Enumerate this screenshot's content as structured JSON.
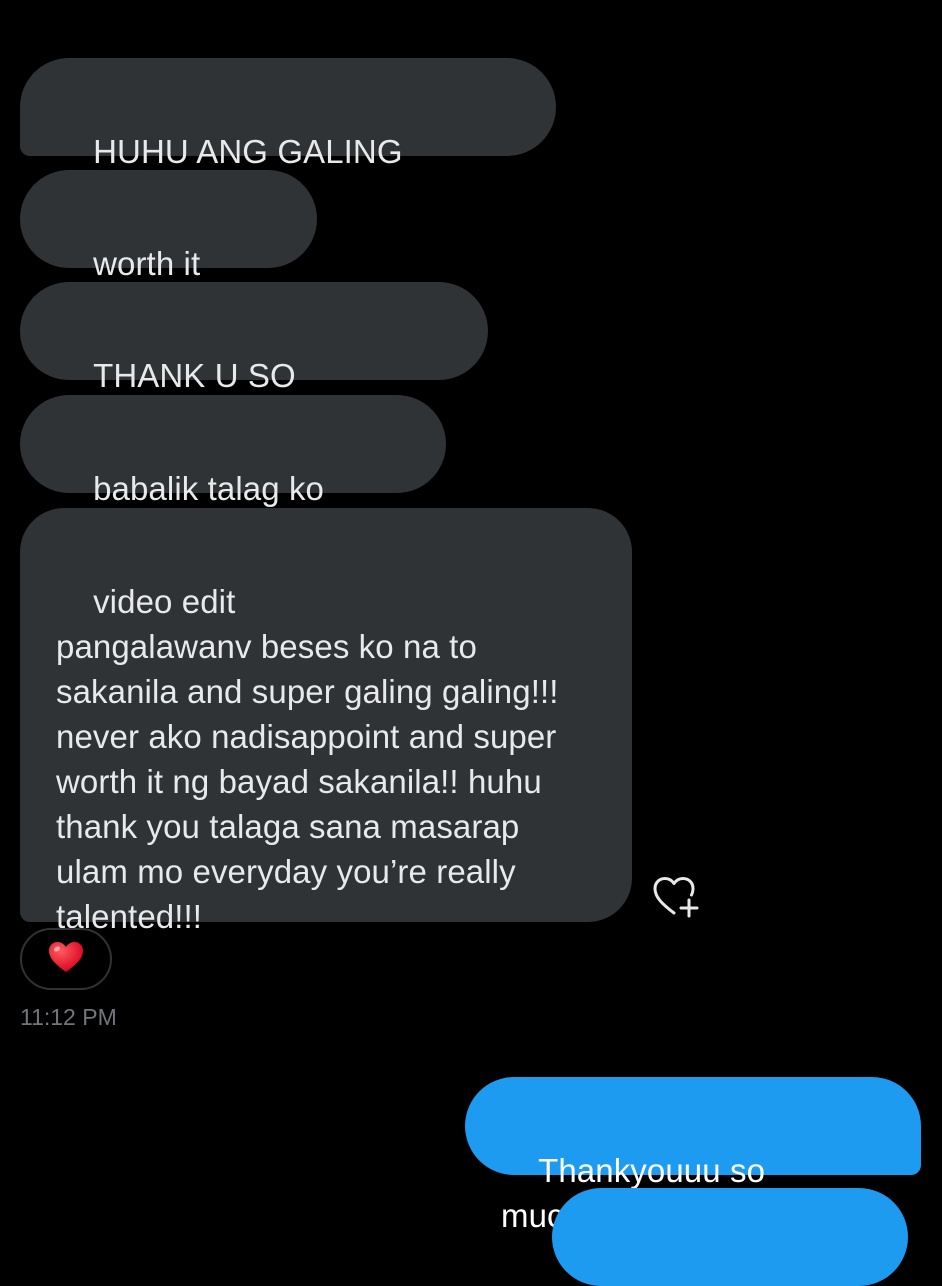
{
  "conversation": {
    "received_messages": [
      {
        "text": "HUHU ANG GALING MOOOO"
      },
      {
        "text": "worth it talaga"
      },
      {
        "text": "THANK U SO MUCHHHH"
      },
      {
        "text": "babalik talag ko sayo!!!"
      },
      {
        "text": "video edit\npangalawanv beses ko na to\nsakanila and super galing galing!!!\nnever ako nadisappoint and super\nworth it ng bayad sakanila!! huhu\nthank you talaga sana masarap\nulam mo everyday you’re really\ntalented!!!"
      }
    ],
    "reaction": {
      "emoji": "❤️",
      "icon": "red-heart-icon"
    },
    "add_reaction_icon": "heart-plus-icon",
    "timestamp": "11:12 PM",
    "sent_messages": [
      {
        "text": "Thankyouuu so muchh!!!"
      }
    ]
  },
  "colors": {
    "background": "#000000",
    "received_bubble": "#2f3336",
    "sent_bubble": "#1d9bf0",
    "text": "#e7e9ea",
    "timestamp": "#71767b",
    "heart_red": "#f91880"
  }
}
